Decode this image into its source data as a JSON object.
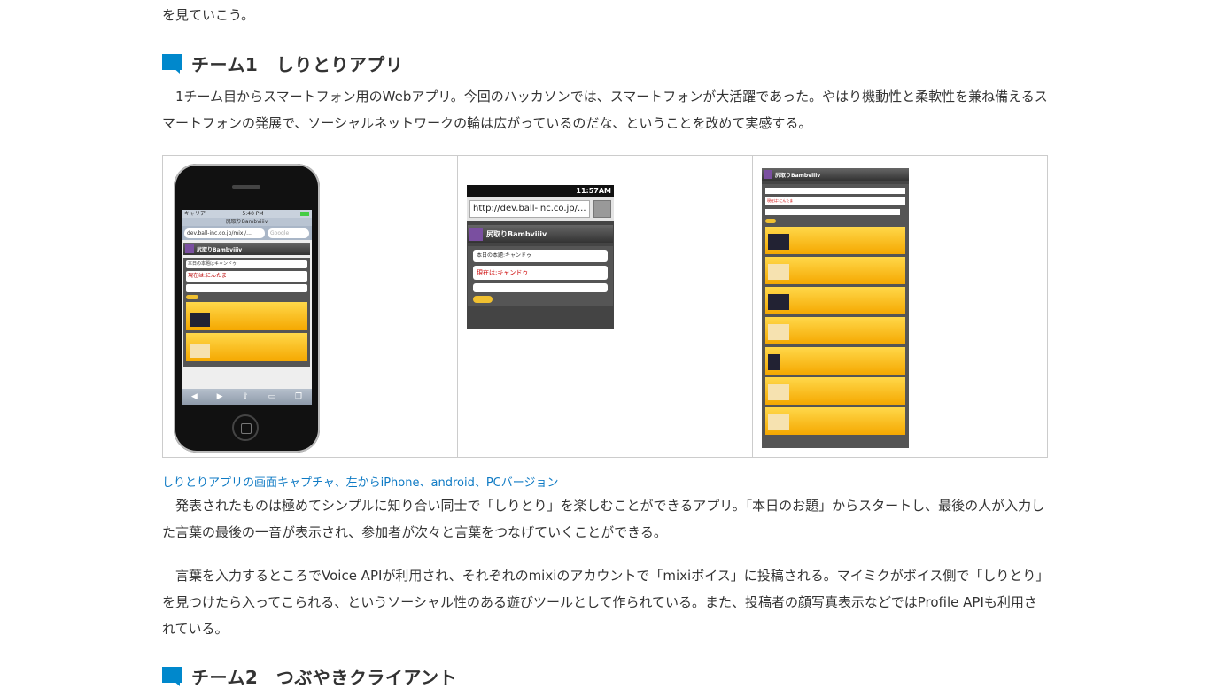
{
  "intro": {
    "tail": "を見ていこう。"
  },
  "team1": {
    "heading": "チーム1　しりとりアプリ",
    "para1": "　1チーム目からスマートフォン用のWebアプリ。今回のハッカソンでは、スマートフォンが大活躍であった。やはり機動性と柔軟性を兼ね備えるスマートフォンの発展で、ソーシャルネットワークの輪は広がっているのだな、ということを改めて実感する。",
    "caption": "しりとりアプリの画面キャプチャ、左からiPhone、android、PCバージョン",
    "para2": "　発表されたものは極めてシンプルに知り合い同士で「しりとり」を楽しむことができるアプリ。「本日のお題」からスタートし、最後の人が入力した言葉の最後の一音が表示され、参加者が次々と言葉をつなげていくことができる。",
    "para3": "　言葉を入力するところでVoice APIが利用され、それぞれのmixiのアカウントで「mixiボイス」に投稿される。マイミクがボイス側で「しりとり」を見つけたら入ってこられる、というソーシャル性のある遊びツールとして作られている。また、投稿者の顔写真表示などではProfile APIも利用されている。"
  },
  "team2": {
    "heading": "チーム2　つぶやきクライアント"
  },
  "screens": {
    "iphone": {
      "carrier": "キャリア",
      "time": "5:40 PM",
      "page_title": "尻取りBambviiiv",
      "url": "dev.ball-inc.co.jp/mixi/...",
      "search_placeholder": "Google",
      "app_title": "尻取りBambviiiv",
      "topic": "本日の本題はキャンドゥ",
      "current": "現在は:にんたま"
    },
    "android": {
      "time": "11:57AM",
      "url": "http://dev.ball-inc.co.jp/...",
      "app_title": "尻取りBambviiiv",
      "topic": "本日の本題:キャンドゥ",
      "current": "現在は:キャンドゥ"
    },
    "pc": {
      "app_title": "尻取りBambviiiv",
      "current": "現在は:にんたま"
    }
  },
  "colors": {
    "accent": "#0088cc",
    "link": "#0e7ac4",
    "text": "#333333"
  }
}
